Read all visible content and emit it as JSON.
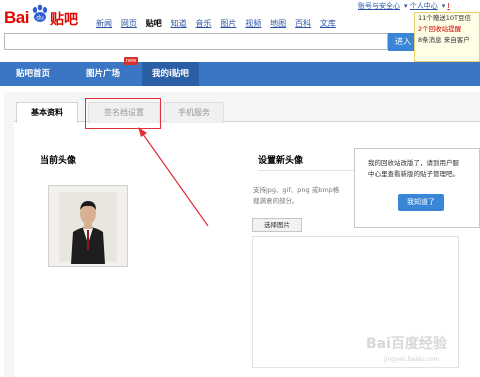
{
  "header": {
    "logo_bai": "Bai",
    "logo_tieba": "贴吧",
    "nav": [
      "新闻",
      "网页",
      "贴吧",
      "知道",
      "音乐",
      "图片",
      "视频",
      "地图",
      "百科",
      "文库"
    ],
    "nav_current_index": 2,
    "top_links": [
      "账号与安全心",
      "个人中心",
      "I"
    ],
    "search_value": "",
    "enter_label": "进入"
  },
  "notification": {
    "line1": "11个赠送10T豆信",
    "line2": "2个回收站提醒",
    "line3": "8条消息 来自客户"
  },
  "navbar": {
    "items": [
      "贴吧首页",
      "图片广场",
      "我的i贴吧"
    ],
    "badge": "new"
  },
  "tabs": [
    "基本资料",
    "签名档设置",
    "手机服务"
  ],
  "left": {
    "title": "当前头像"
  },
  "right": {
    "title": "设置新头像",
    "support_line1": "支持jpg、gif、png 或bmp格",
    "support_line2": "裁满意的部分。",
    "choose_label": "选择图片"
  },
  "popup": {
    "line1": "我的回收站改版了，请到用户服",
    "line2": "中心里查看新版的贴子管理吧。",
    "button": "我知道了"
  },
  "watermark": {
    "text": "Bai百度经验",
    "sub": "jingyan.baidu.com"
  },
  "colors": {
    "brand_red": "#e10601",
    "nav_blue": "#3b76c4",
    "button_blue": "#3a86d6",
    "annotation_red": "#e0303a"
  }
}
